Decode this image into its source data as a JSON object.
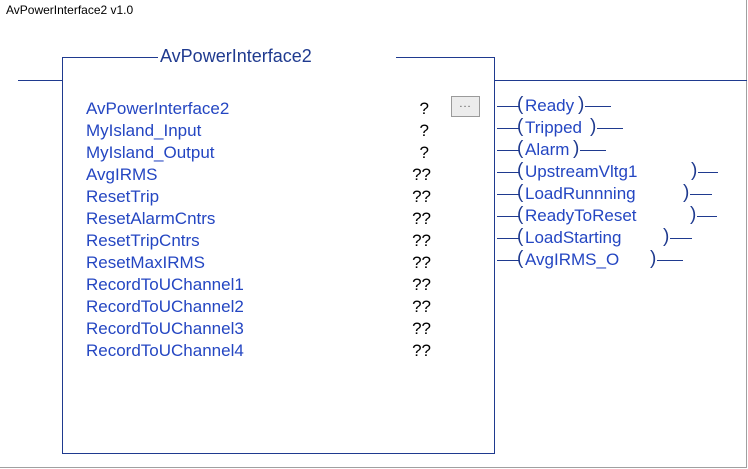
{
  "header": {
    "title": "AvPowerInterface2 v1.0"
  },
  "block": {
    "title": "AvPowerInterface2",
    "more_button": "..."
  },
  "parameters": [
    {
      "name": "AvPowerInterface2",
      "value": "?"
    },
    {
      "name": "MyIsland_Input",
      "value": "?"
    },
    {
      "name": "MyIsland_Output",
      "value": "?"
    },
    {
      "name": "AvgIRMS",
      "value": "??"
    },
    {
      "name": "ResetTrip",
      "value": "??"
    },
    {
      "name": "ResetAlarmCntrs",
      "value": "??"
    },
    {
      "name": "ResetTripCntrs",
      "value": "??"
    },
    {
      "name": "ResetMaxIRMS",
      "value": "??"
    },
    {
      "name": "RecordToUChannel1",
      "value": "??"
    },
    {
      "name": "RecordToUChannel2",
      "value": "??"
    },
    {
      "name": "RecordToUChannel3",
      "value": "??"
    },
    {
      "name": "RecordToUChannel4",
      "value": "??"
    }
  ],
  "outputs": [
    {
      "label": "Ready"
    },
    {
      "label": "Tripped"
    },
    {
      "label": "Alarm"
    },
    {
      "label": "UpstreamVltg1"
    },
    {
      "label": "LoadRunnning"
    },
    {
      "label": "ReadyToReset"
    },
    {
      "label": "LoadStarting"
    },
    {
      "label": "AvgIRMS_O"
    }
  ]
}
